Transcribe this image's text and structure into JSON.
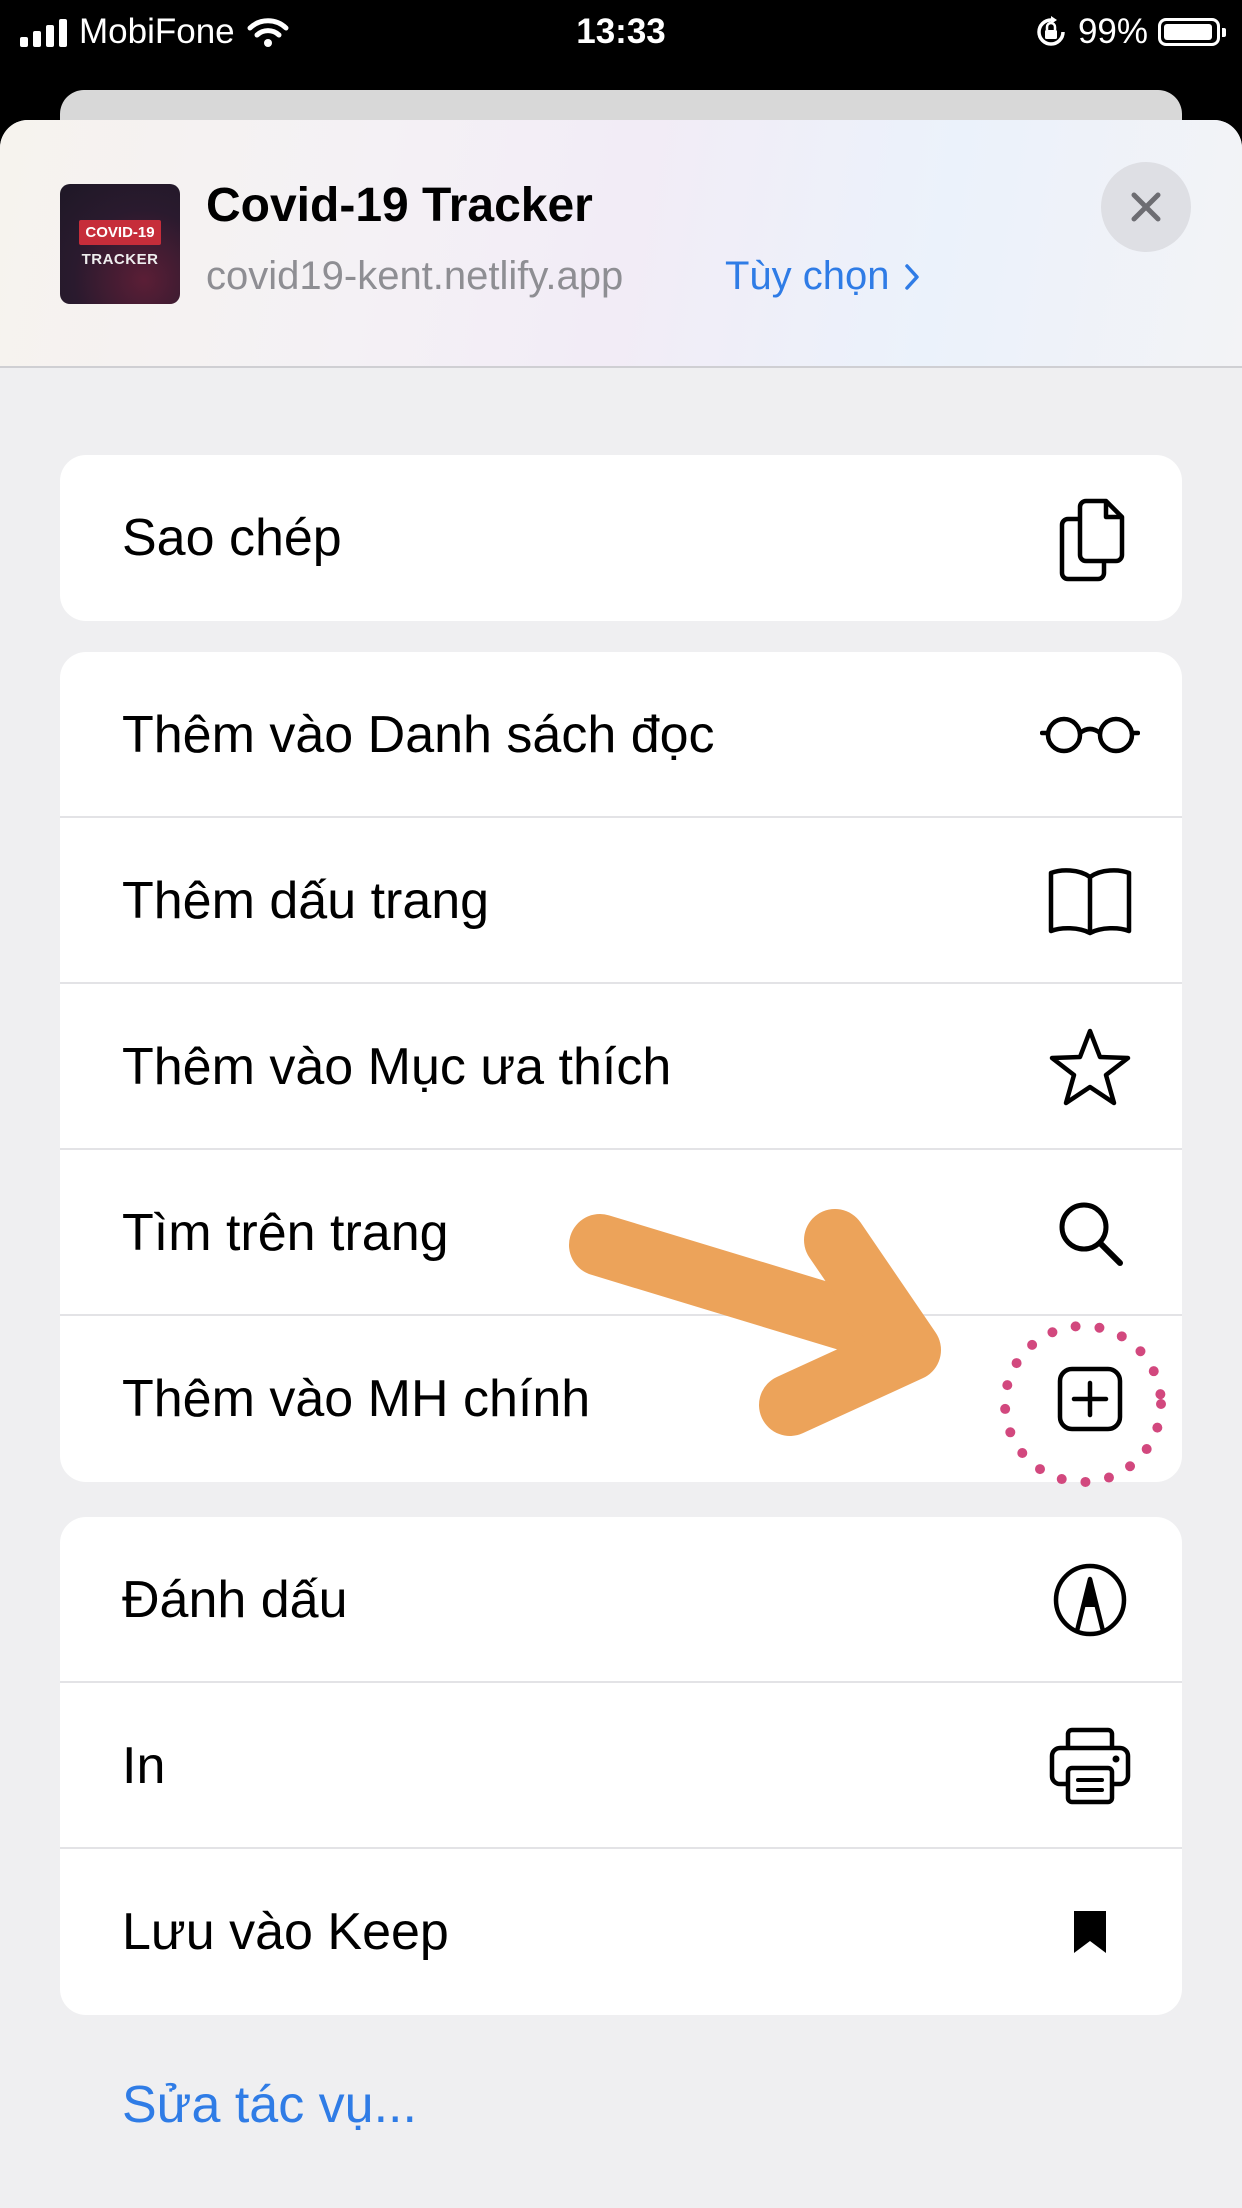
{
  "status_bar": {
    "carrier": "MobiFone",
    "time": "13:33",
    "battery": "99%"
  },
  "header": {
    "app_icon": {
      "badge": "COVID-19",
      "subtitle": "TRACKER"
    },
    "title": "Covid-19 Tracker",
    "url": "covid19-kent.netlify.app",
    "options_label": "Tùy chọn",
    "close_icon": "close-icon"
  },
  "groups": [
    {
      "items": [
        {
          "label": "Sao chép",
          "icon": "copy-icon"
        }
      ]
    },
    {
      "items": [
        {
          "label": "Thêm vào Danh sách đọc",
          "icon": "glasses-icon"
        },
        {
          "label": "Thêm dấu trang",
          "icon": "book-icon"
        },
        {
          "label": "Thêm vào Mục ưa thích",
          "icon": "star-icon"
        },
        {
          "label": "Tìm trên trang",
          "icon": "search-icon"
        },
        {
          "label": "Thêm vào MH chính",
          "icon": "add-square-icon"
        }
      ]
    },
    {
      "items": [
        {
          "label": "Đánh dấu",
          "icon": "markup-icon"
        },
        {
          "label": "In",
          "icon": "printer-icon"
        },
        {
          "label": "Lưu vào Keep",
          "icon": "bookmark-icon"
        }
      ]
    }
  ],
  "edit_actions_label": "Sửa tác vụ...",
  "colors": {
    "accent": "#2f7ce6",
    "annotation_arrow": "#eca35a",
    "annotation_circle": "#d2487e"
  }
}
